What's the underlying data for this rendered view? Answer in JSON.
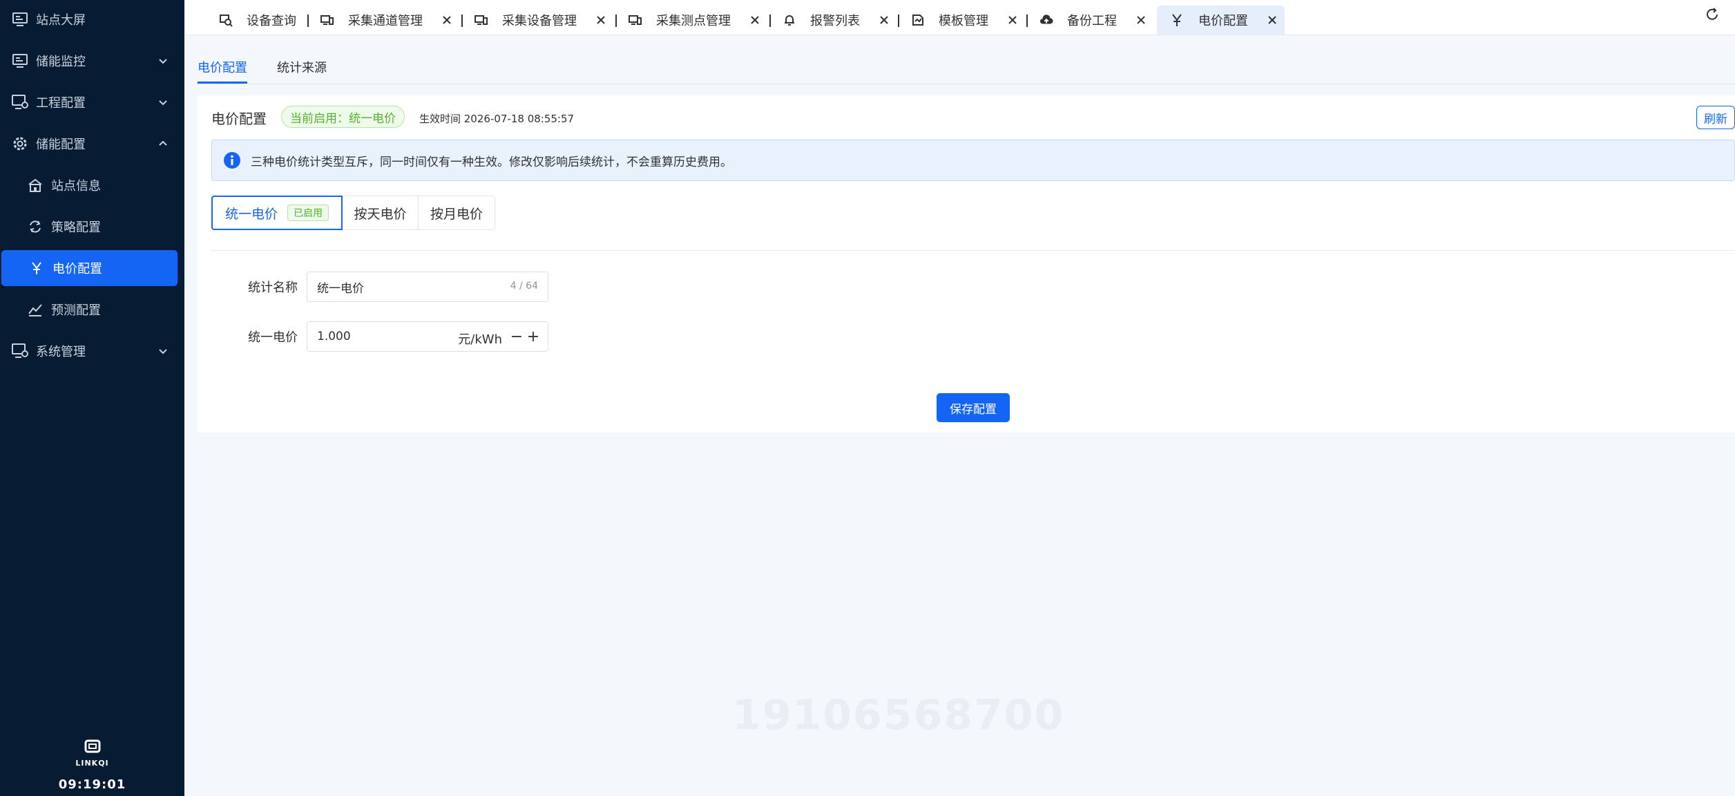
{
  "sidebar": {
    "items": [
      {
        "label": "站点大屏",
        "icon": "monitor-icon"
      },
      {
        "label": "储能监控",
        "icon": "monitor-icon"
      },
      {
        "label": "工程配置",
        "icon": "monitor-settings-icon"
      },
      {
        "label": "储能配置",
        "icon": "gear-icon"
      },
      {
        "label": "站点信息",
        "icon": "home-icon"
      },
      {
        "label": "策略配置",
        "icon": "refresh-cycle-icon"
      },
      {
        "label": "电价配置",
        "icon": "yen-icon"
      },
      {
        "label": "预测配置",
        "icon": "chart-trend-icon"
      },
      {
        "label": "系统管理",
        "icon": "monitor-settings-icon"
      }
    ],
    "brand": "LINKQI",
    "clock": "09:19:01"
  },
  "tabs": [
    {
      "label": "设备查询",
      "icon": "search-device-icon",
      "closable": false
    },
    {
      "label": "采集通道管理",
      "icon": "devices-icon",
      "closable": true
    },
    {
      "label": "采集设备管理",
      "icon": "devices-icon",
      "closable": true
    },
    {
      "label": "采集测点管理",
      "icon": "devices-icon",
      "closable": true
    },
    {
      "label": "报警列表",
      "icon": "bell-icon",
      "closable": true
    },
    {
      "label": "模板管理",
      "icon": "template-icon",
      "closable": true
    },
    {
      "label": "备份工程",
      "icon": "cloud-upload-icon",
      "closable": true
    },
    {
      "label": "电价配置",
      "icon": "yen-icon",
      "closable": true,
      "active": true
    }
  ],
  "subtabs": {
    "active": "电价配置",
    "other": "统计来源"
  },
  "card": {
    "title": "电价配置",
    "status": "当前启用：统一电价",
    "effective": "生效时间 2026-07-18 08:55:57",
    "refresh": "刷新",
    "alert": "三种电价统计类型互斥，同一时间仅有一种生效。修改仅影响后续统计，不会重算历史费用。",
    "segments": [
      "统一电价",
      "按天电价",
      "按月电价"
    ],
    "used_badge": "已启用",
    "form": {
      "name_label": "统计名称",
      "name_value": "统一电价",
      "name_count": "4 / 64",
      "price_label": "统一电价",
      "price_value": "1.000",
      "price_unit": "元/kWh",
      "minus": "−",
      "plus": "+"
    },
    "save": "保存配置"
  },
  "watermark": "19106568700",
  "colors": {
    "accent": "#1565f4",
    "sidebar": "#071b33",
    "success": "#52b32a"
  }
}
